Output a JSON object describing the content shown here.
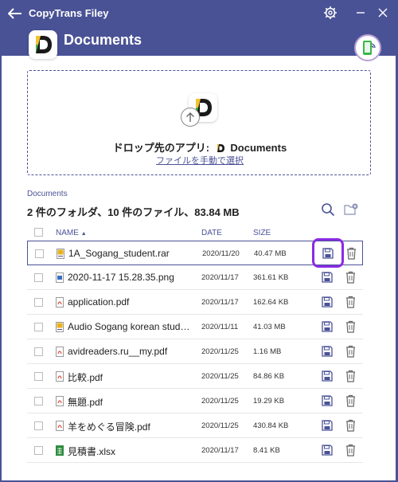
{
  "window": {
    "title": "CopyTrans Filey"
  },
  "app": {
    "name": "Documents"
  },
  "dropzone": {
    "prefix": "ドロップ先のアプリ:",
    "app_name": "Documents",
    "link": "ファイルを手動で選択"
  },
  "breadcrumb": "Documents",
  "summary": "2 件のフォルダ、10 件のファイル、83.84 MB",
  "table": {
    "headers": {
      "name": "NAME",
      "date": "DATE",
      "size": "SIZE"
    },
    "sort_indicator": "▲",
    "rows": [
      {
        "name": "1A_Sogang_student.rar",
        "date": "2020/11/20",
        "size": "40.47 MB",
        "type": "archive",
        "selected": true
      },
      {
        "name": "2020-11-17 15.28.35.png",
        "date": "2020/11/17",
        "size": "361.61 KB",
        "type": "image",
        "selected": false
      },
      {
        "name": "application.pdf",
        "date": "2020/11/17",
        "size": "162.64 KB",
        "type": "pdf",
        "selected": false
      },
      {
        "name": "Audio Sogang korean studen…",
        "date": "2020/11/11",
        "size": "41.03 MB",
        "type": "archive",
        "selected": false
      },
      {
        "name": "avidreaders.ru__my.pdf",
        "date": "2020/11/25",
        "size": "1.16 MB",
        "type": "pdf",
        "selected": false
      },
      {
        "name": "比較.pdf",
        "date": "2020/11/25",
        "size": "84.86 KB",
        "type": "pdf",
        "selected": false
      },
      {
        "name": "無題.pdf",
        "date": "2020/11/25",
        "size": "19.29 KB",
        "type": "pdf",
        "selected": false
      },
      {
        "name": "羊をめぐる冒険.pdf",
        "date": "2020/11/25",
        "size": "430.84 KB",
        "type": "pdf",
        "selected": false
      },
      {
        "name": "見積書.xlsx",
        "date": "2020/11/17",
        "size": "8.41 KB",
        "type": "spreadsheet",
        "selected": false
      }
    ]
  },
  "icons": {
    "back": "back-arrow-icon",
    "settings": "gear-icon",
    "minimize": "minimize-icon",
    "close": "close-icon",
    "search": "search-icon",
    "new_folder": "new-folder-icon",
    "save": "save-icon",
    "delete": "trash-icon",
    "device": "phone-wifi-icon",
    "upload": "upload-arrow-icon"
  },
  "colors": {
    "brand": "#4a5296",
    "highlight": "#8a2be2",
    "pdf": "#e04b3a",
    "archive": "#e8b21a",
    "image": "#3a6fc4",
    "spreadsheet": "#2e8b3e"
  }
}
